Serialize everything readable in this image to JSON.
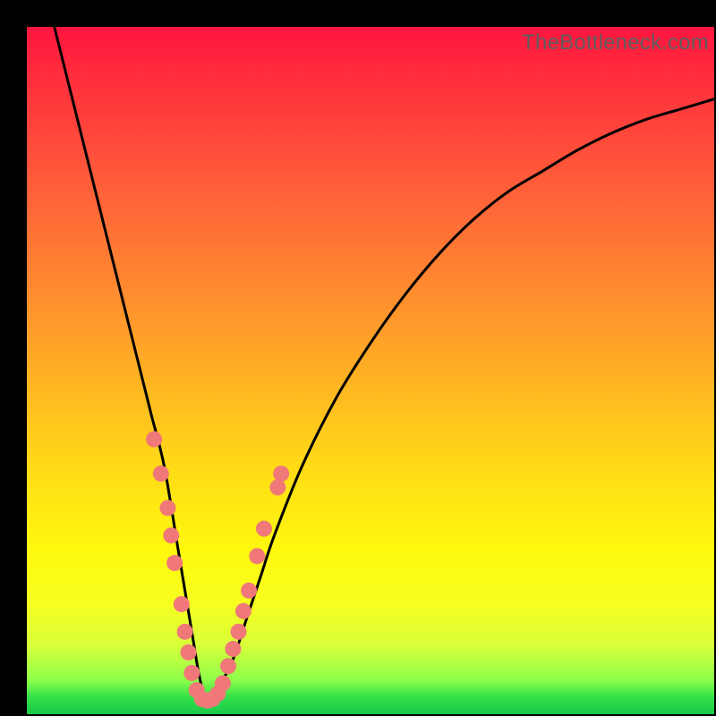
{
  "watermark": "TheBottleneck.com",
  "colors": {
    "background": "#000000",
    "curve": "#000000",
    "marker": "#f07878",
    "gradient_top": "#ff153f",
    "gradient_bottom": "#18c84a"
  },
  "chart_data": {
    "type": "line",
    "title": "",
    "xlabel": "",
    "ylabel": "",
    "xlim": [
      0,
      100
    ],
    "ylim": [
      0,
      100
    ],
    "note": "No axes, ticks, or numeric labels are rendered in the image; x and y are normalized 0–100. Curve is a V-shaped bottleneck profile with minimum near x≈26.",
    "series": [
      {
        "name": "bottleneck-curve",
        "x": [
          4,
          6,
          8,
          10,
          12,
          14,
          16,
          18,
          20,
          22,
          24,
          25,
          26,
          27,
          28,
          30,
          32,
          34,
          36,
          40,
          45,
          50,
          55,
          60,
          65,
          70,
          75,
          80,
          85,
          90,
          95,
          100
        ],
        "values": [
          100,
          92,
          84,
          76,
          68,
          60,
          52,
          44,
          36,
          24,
          12,
          6,
          2,
          2,
          4,
          8,
          14,
          20,
          26,
          36,
          46,
          54,
          61,
          67,
          72,
          76,
          79,
          82,
          84.5,
          86.5,
          88,
          89.5
        ]
      }
    ],
    "markers": {
      "name": "highlighted-points",
      "comment": "Pink dot clusters near the valley of the curve",
      "points": [
        {
          "x": 18.5,
          "y": 40
        },
        {
          "x": 19.5,
          "y": 35
        },
        {
          "x": 20.5,
          "y": 30
        },
        {
          "x": 21.0,
          "y": 26
        },
        {
          "x": 21.5,
          "y": 22
        },
        {
          "x": 22.5,
          "y": 16
        },
        {
          "x": 23.0,
          "y": 12
        },
        {
          "x": 23.5,
          "y": 9
        },
        {
          "x": 24.0,
          "y": 6
        },
        {
          "x": 24.7,
          "y": 3.5
        },
        {
          "x": 25.5,
          "y": 2.2
        },
        {
          "x": 26.3,
          "y": 2.0
        },
        {
          "x": 27.0,
          "y": 2.2
        },
        {
          "x": 27.8,
          "y": 3.0
        },
        {
          "x": 28.5,
          "y": 4.5
        },
        {
          "x": 29.3,
          "y": 7
        },
        {
          "x": 30.0,
          "y": 9.5
        },
        {
          "x": 30.8,
          "y": 12
        },
        {
          "x": 31.5,
          "y": 15
        },
        {
          "x": 32.3,
          "y": 18
        },
        {
          "x": 33.5,
          "y": 23
        },
        {
          "x": 34.5,
          "y": 27
        },
        {
          "x": 36.5,
          "y": 33
        },
        {
          "x": 37.0,
          "y": 35
        }
      ]
    }
  }
}
